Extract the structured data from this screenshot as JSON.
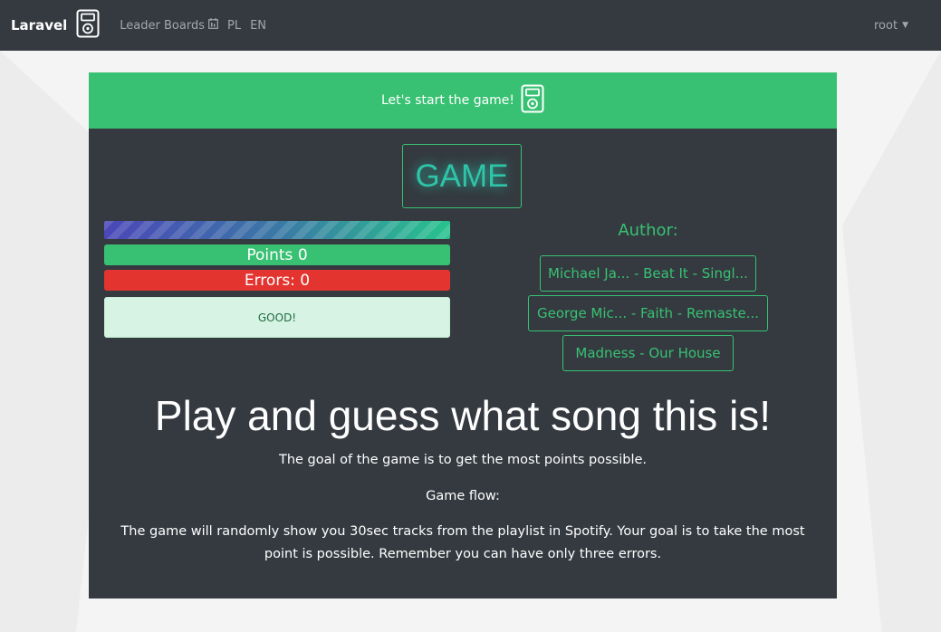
{
  "navbar": {
    "brand": "Laravel",
    "brand_icon": "ipod-icon",
    "links": [
      {
        "label": "Leader Boards",
        "icon": "calendar-icon"
      },
      {
        "label": "PL"
      },
      {
        "label": "EN"
      }
    ],
    "user": "root"
  },
  "card": {
    "header_title": "Let's start the game!",
    "header_icon": "ipod-icon",
    "game_label": "GAME",
    "progress_percent": 100,
    "points_text": "Points 0",
    "errors_text": "Errors: 0",
    "status_text": "GOOD!",
    "author_label": "Author:",
    "answers": [
      "Michael Ja... - Beat It - Singl...",
      "George Mic... - Faith - Remaste...",
      "Madness - Our House"
    ],
    "heading": "Play and guess what song this is!",
    "goal_text": "The goal of the game is to get the most points possible.",
    "flow_label": "Game flow:",
    "flow_text": "The game will randomly show you 30sec tracks from the playlist in Spotify. Your goal is to take the most point is possible. Remember you can have only three errors."
  },
  "colors": {
    "navbar_bg": "#343a40",
    "accent_green": "#38c172",
    "error_red": "#e3342f",
    "card_bg": "#343a40"
  }
}
